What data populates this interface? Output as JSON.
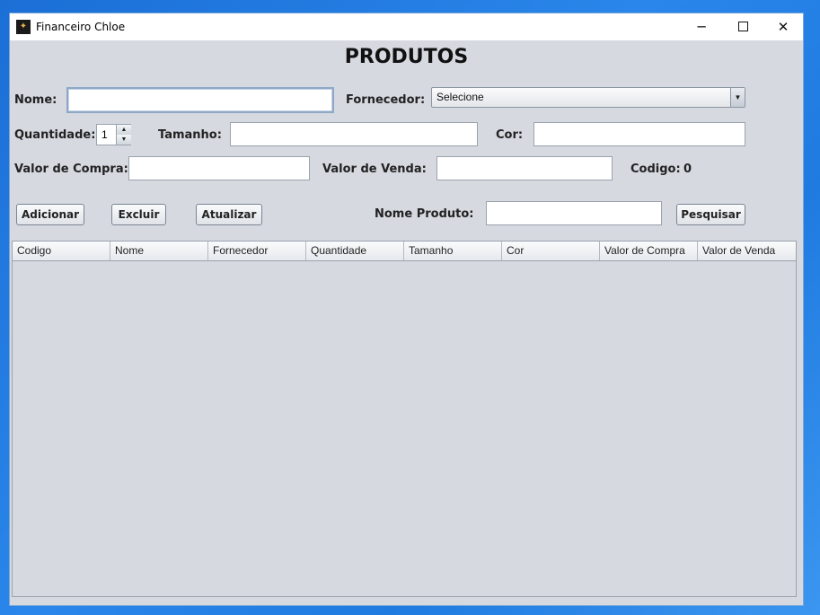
{
  "window": {
    "title": "Financeiro Chloe",
    "app_icon": "chloe-app-icon",
    "controls": {
      "minimize": "─",
      "maximize": "□",
      "close": "✕"
    }
  },
  "form": {
    "heading": "PRODUTOS",
    "nome_label": "Nome:",
    "nome_value": "",
    "fornecedor_label": "Fornecedor:",
    "fornecedor_selected": "Selecione",
    "quantidade_label": "Quantidade:",
    "quantidade_value": "1",
    "tamanho_label": "Tamanho:",
    "tamanho_value": "",
    "cor_label": "Cor:",
    "cor_value": "",
    "valor_compra_label": "Valor de Compra:",
    "valor_compra_value": "",
    "valor_venda_label": "Valor de Venda:",
    "valor_venda_value": "",
    "codigo_label": "Codigo:",
    "codigo_value": "0"
  },
  "actions": {
    "adicionar": "Adicionar",
    "excluir": "Excluir",
    "atualizar": "Atualizar",
    "nome_produto_label": "Nome Produto:",
    "nome_produto_value": "",
    "pesquisar": "Pesquisar"
  },
  "table": {
    "columns": [
      "Codigo",
      "Nome",
      "Fornecedor",
      "Quantidade",
      "Tamanho",
      "Cor",
      "Valor de Compra",
      "Valor de Venda"
    ],
    "rows": []
  },
  "colors": {
    "window_background": "#d6d9e0",
    "desktop_accent": "#1f7be0"
  }
}
